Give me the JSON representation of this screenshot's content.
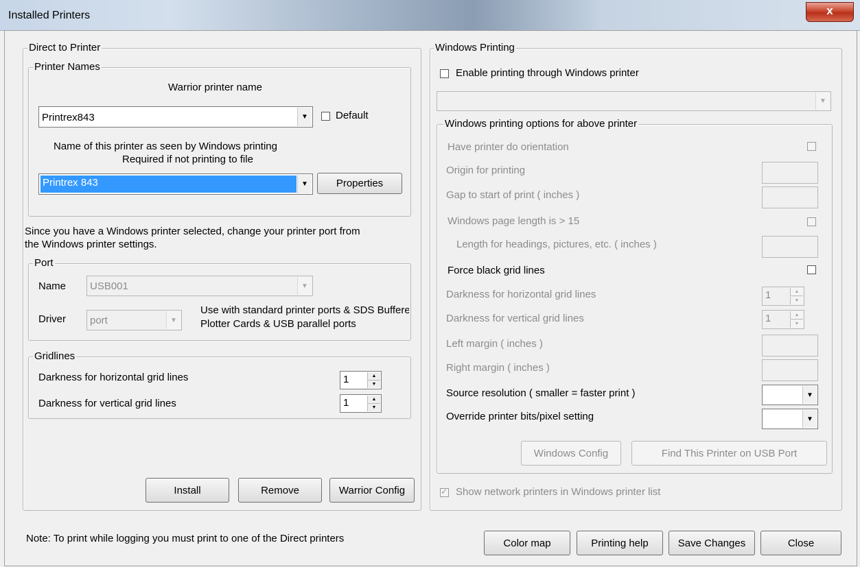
{
  "window": {
    "title": "Installed Printers",
    "close_label": "x"
  },
  "direct": {
    "legend": "Direct to Printer",
    "printer_names": {
      "legend": "Printer Names",
      "warrior_label": "Warrior printer name",
      "warrior_value": "Printrex843",
      "default_label": "Default",
      "windows_label_1": "Name of this printer as seen by Windows printing",
      "windows_label_2": "Required if not printing to file",
      "windows_value": "Printrex 843",
      "properties_label": "Properties"
    },
    "port_note_1": "Since you have a Windows printer selected, change your printer port from",
    "port_note_2": "the Windows printer settings.",
    "port": {
      "legend": "Port",
      "name_label": "Name",
      "name_value": "USB001",
      "driver_label": "Driver",
      "driver_value": "port",
      "driver_note_1": "Use with standard printer ports & SDS Buffered",
      "driver_note_2": "Plotter Cards & USB parallel ports"
    },
    "gridlines": {
      "legend": "Gridlines",
      "horizontal_label": "Darkness for horizontal grid lines",
      "horizontal_value": "1",
      "vertical_label": "Darkness for vertical grid lines",
      "vertical_value": "1"
    },
    "buttons": {
      "install": "Install",
      "remove": "Remove",
      "warrior_config": "Warrior Config"
    }
  },
  "windows": {
    "legend": "Windows Printing",
    "enable_label": "Enable printing through Windows printer",
    "options": {
      "legend": "Windows printing options for above printer",
      "orientation_label": "Have printer do orientation",
      "origin_label": "Origin for printing",
      "gap_label": "Gap to start of print ( inches )",
      "page_length_label": "Windows page length is > 15",
      "length_headings_label": "Length for headings, pictures, etc. ( inches )",
      "force_black_label": "Force black grid lines",
      "dark_h_label": "Darkness for horizontal grid lines",
      "dark_h_value": "1",
      "dark_v_label": "Darkness for vertical grid lines",
      "dark_v_value": "1",
      "left_margin_label": "Left margin ( inches )",
      "right_margin_label": "Right margin ( inches )",
      "source_res_label": "Source resolution ( smaller = faster print )",
      "override_bits_label": "Override printer bits/pixel setting",
      "windows_config": "Windows Config",
      "find_usb": "Find This Printer on USB Port"
    },
    "show_network_label": "Show network printers in Windows printer list"
  },
  "footer": {
    "note": "Note: To print while logging you must print to one of the Direct printers",
    "color_map": "Color map",
    "printing_help": "Printing help",
    "save_changes": "Save Changes",
    "close": "Close"
  }
}
